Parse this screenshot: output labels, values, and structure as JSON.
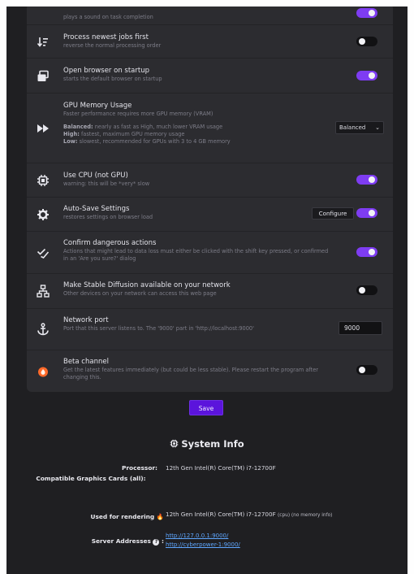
{
  "settings": {
    "sound_desc": "plays a sound on task completion",
    "process_newest": {
      "title": "Process newest jobs first",
      "desc": "reverse the normal processing order"
    },
    "open_browser": {
      "title": "Open browser on startup",
      "desc": "starts the default browser on startup"
    },
    "gpu_memory": {
      "title": "GPU Memory Usage",
      "desc": "Faster performance requires more GPU memory (VRAM)",
      "balanced_label": "Balanced:",
      "balanced_text": "nearly as fast as High, much lower VRAM usage",
      "high_label": "High:",
      "high_text": "fastest, maximum GPU memory usage",
      "low_label": "Low:",
      "low_text": "slowest, recommended for GPUs with 3 to 4 GB memory",
      "selected": "Balanced"
    },
    "use_cpu": {
      "title": "Use CPU (not GPU)",
      "desc": "warning: this will be *very* slow"
    },
    "auto_save": {
      "title": "Auto-Save Settings",
      "desc": "restores settings on browser load",
      "configure_label": "Configure"
    },
    "confirm_dangerous": {
      "title": "Confirm dangerous actions",
      "desc": "Actions that might lead to data loss must either be clicked with the shift key pressed, or confirmed in an 'Are you sure?' dialog"
    },
    "network_access": {
      "title": "Make Stable Diffusion available on your network",
      "desc": "Other devices on your network can access this web page"
    },
    "network_port": {
      "title": "Network port",
      "desc": "Port that this server listens to. The '9000' part in 'http://localhost:9000'",
      "value": "9000"
    },
    "beta": {
      "title": "Beta channel",
      "desc": "Get the latest features immediately (but could be less stable). Please restart the program after changing this."
    }
  },
  "save_label": "Save",
  "system_info": {
    "title": "System Info",
    "processor_label": "Processor:",
    "processor_value": "12th Gen Intel(R) Core(TM) i7-12700F",
    "gpus_label": "Compatible Graphics Cards (all):",
    "rendering_label": "Used for rendering",
    "rendering_value": "12th Gen Intel(R) Core(TM) i7-12700F",
    "rendering_note": "(cpu) (no memory info)",
    "server_label": "Server Addresses",
    "server_addr_1": "http://127.0.0.1:9000/",
    "server_addr_2": "http://cyberpower-1:9000/"
  },
  "colors": {
    "accent": "#7e3cf2",
    "save": "#5b14dc",
    "link": "#5fa7ff",
    "beta_icon": "#ff6a2a"
  }
}
